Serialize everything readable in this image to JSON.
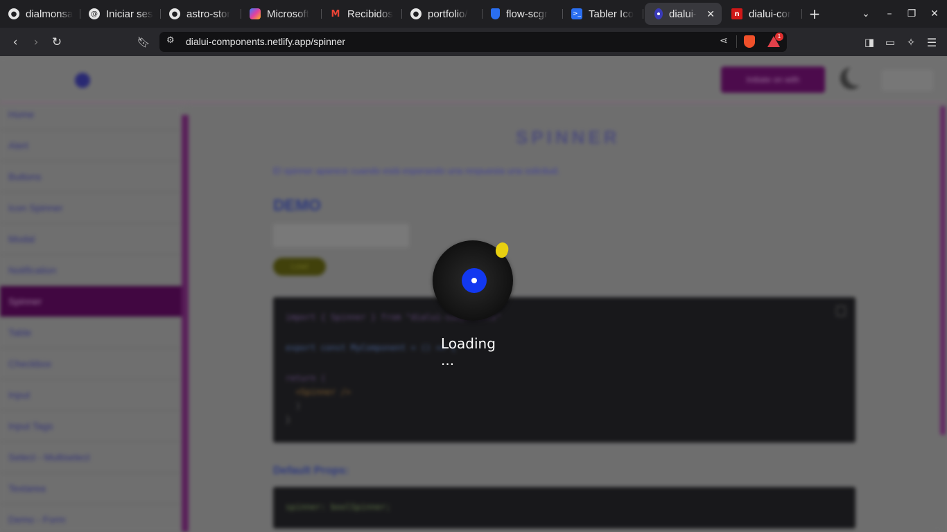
{
  "browser": {
    "tabs": [
      {
        "title": "dialmonsa",
        "icon": "github-icon"
      },
      {
        "title": "Iniciar ses",
        "icon": "threads-icon"
      },
      {
        "title": "astro-stor",
        "icon": "github-icon"
      },
      {
        "title": "Microsoft",
        "icon": "copilot-icon"
      },
      {
        "title": "Recibidos",
        "icon": "gmail-icon"
      },
      {
        "title": "portfolio/",
        "icon": "github-icon"
      },
      {
        "title": "flow-scgr",
        "icon": "shield-icon"
      },
      {
        "title": "Tabler Ico",
        "icon": "terminal-icon"
      },
      {
        "title": "dialui-",
        "icon": "dialui-icon",
        "active": true
      },
      {
        "title": "dialui-cor",
        "icon": "netlify-icon"
      }
    ],
    "url": "dialui-components.netlify.app/spinner",
    "brave_badge_count": "1"
  },
  "page": {
    "header": {
      "github_button": "Initiate on with"
    },
    "sidebar": {
      "items": [
        "Home",
        "Alert",
        "Buttons",
        "Icon Spinner",
        "Modal",
        "Notification",
        "Spinner",
        "Table",
        "Checkbox",
        "Input",
        "Input Tags",
        "Select - Multiselect",
        "Textarea",
        "Demo - Form"
      ],
      "active": "Spinner"
    },
    "content": {
      "title": "SPINNER",
      "description": "El spinner aparece cuando está esperando una respuesta una solicitud.",
      "demo_heading": "DEMO",
      "demo_button": "Load",
      "code_lines": [
        "import { Spinner } from \"dialui-components\"",
        "",
        "export const MyComponent = () => {",
        "",
        "return (",
        "  <Spinner />",
        "  )",
        "}"
      ],
      "props_heading": "Default Props:",
      "props_code": "spinner: boolSpinner;"
    },
    "loader": {
      "text": "Loading ..."
    }
  },
  "colors": {
    "accent": "#6a106a",
    "disc_label": "#1238f0",
    "pick": "#e8d010"
  }
}
